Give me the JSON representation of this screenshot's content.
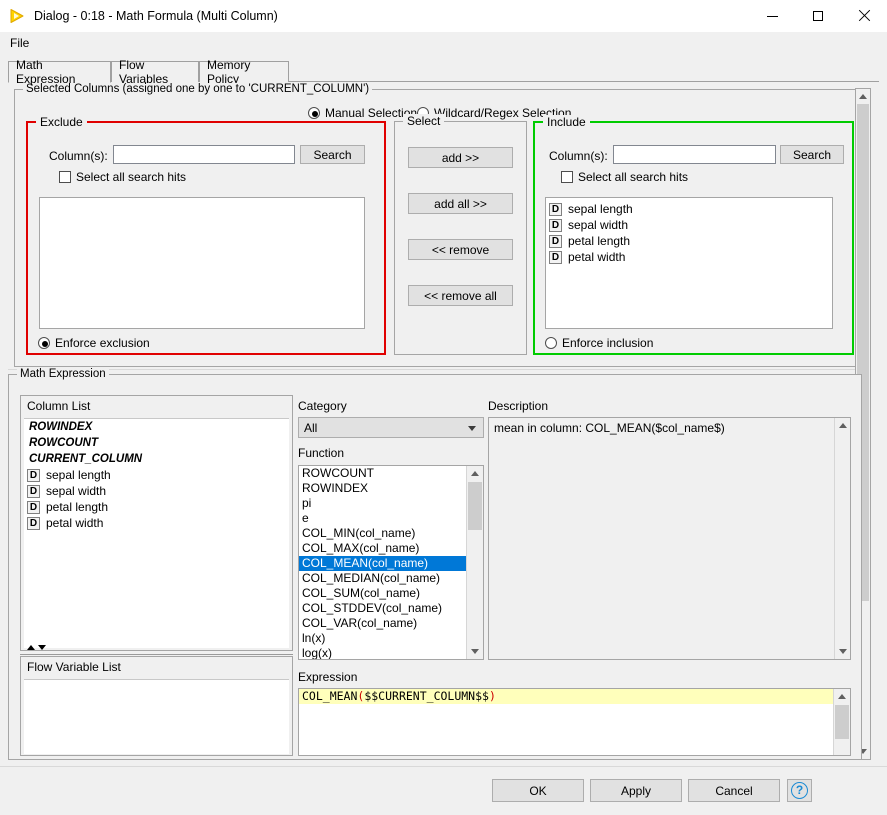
{
  "window": {
    "title": "Dialog - 0:18 - Math Formula (Multi Column)",
    "icon": "knime-triangle-icon",
    "minimize_label": "Minimize",
    "maximize_label": "Maximize",
    "close_label": "Close"
  },
  "menubar": {
    "items": [
      "File"
    ]
  },
  "tabs": [
    {
      "label": "Math Expression",
      "active": true
    },
    {
      "label": "Flow Variables",
      "active": false
    },
    {
      "label": "Memory Policy",
      "active": false
    }
  ],
  "selected_columns": {
    "group_title": "Selected Columns (assigned one by one to 'CURRENT_COLUMN')",
    "mode": {
      "manual": {
        "label": "Manual Selection",
        "selected": true
      },
      "wildcard": {
        "label": "Wildcard/Regex Selection",
        "selected": false
      }
    },
    "exclude": {
      "title": "Exclude",
      "border_color": "#e00000",
      "columns_label": "Column(s):",
      "search_value": "",
      "search_button": "Search",
      "select_all_hits": {
        "label": "Select all search hits",
        "checked": false
      },
      "items": [],
      "enforce": {
        "label": "Enforce exclusion",
        "selected": true
      }
    },
    "select": {
      "title": "Select",
      "buttons": [
        "add >>",
        "add all >>",
        "<< remove",
        "<< remove all"
      ]
    },
    "include": {
      "title": "Include",
      "border_color": "#00cc00",
      "columns_label": "Column(s):",
      "search_value": "",
      "search_button": "Search",
      "select_all_hits": {
        "label": "Select all search hits",
        "checked": false
      },
      "items": [
        {
          "icon": "double-type-icon",
          "label": "sepal length"
        },
        {
          "icon": "double-type-icon",
          "label": "sepal width"
        },
        {
          "icon": "double-type-icon",
          "label": "petal length"
        },
        {
          "icon": "double-type-icon",
          "label": "petal width"
        }
      ],
      "enforce": {
        "label": "Enforce inclusion",
        "selected": false
      }
    }
  },
  "math_expression": {
    "group_title": "Math Expression",
    "column_list": {
      "title": "Column List",
      "items": [
        {
          "icon": "none",
          "label": "ROWINDEX",
          "italic": true
        },
        {
          "icon": "none",
          "label": "ROWCOUNT",
          "italic": true
        },
        {
          "icon": "none",
          "label": "CURRENT_COLUMN",
          "italic": true
        },
        {
          "icon": "double-type-icon",
          "label": "sepal length",
          "italic": false
        },
        {
          "icon": "double-type-icon",
          "label": "sepal width",
          "italic": false
        },
        {
          "icon": "double-type-icon",
          "label": "petal length",
          "italic": false
        },
        {
          "icon": "double-type-icon",
          "label": "petal width",
          "italic": false
        }
      ]
    },
    "flow_variable_list": {
      "title": "Flow Variable List",
      "items": []
    },
    "category": {
      "label": "Category",
      "value": "All",
      "options": [
        "All"
      ]
    },
    "function": {
      "label": "Function",
      "selected": "COL_MEAN(col_name)",
      "items": [
        "ROWCOUNT",
        "ROWINDEX",
        "pi",
        "e",
        "COL_MIN(col_name)",
        "COL_MAX(col_name)",
        "COL_MEAN(col_name)",
        "COL_MEDIAN(col_name)",
        "COL_SUM(col_name)",
        "COL_STDDEV(col_name)",
        "COL_VAR(col_name)",
        "ln(x)",
        "log(x)"
      ]
    },
    "description": {
      "label": "Description",
      "text": "mean in column: COL_MEAN($col_name$)"
    },
    "expression": {
      "label": "Expression",
      "text": "COL_MEAN($$CURRENT_COLUMN$$)",
      "token_name": "COL_MEAN",
      "token_open": "(",
      "token_arg": "$$CURRENT_COLUMN$$",
      "token_close": ")",
      "highlight_color": "#ffffbb",
      "paren_color": "#cc0000"
    }
  },
  "footer": {
    "ok": "OK",
    "apply": "Apply",
    "cancel": "Cancel",
    "help": "?"
  },
  "colors": {
    "accent_selection": "#0078d7",
    "exclude_border": "#e00000",
    "include_border": "#00cc00"
  }
}
